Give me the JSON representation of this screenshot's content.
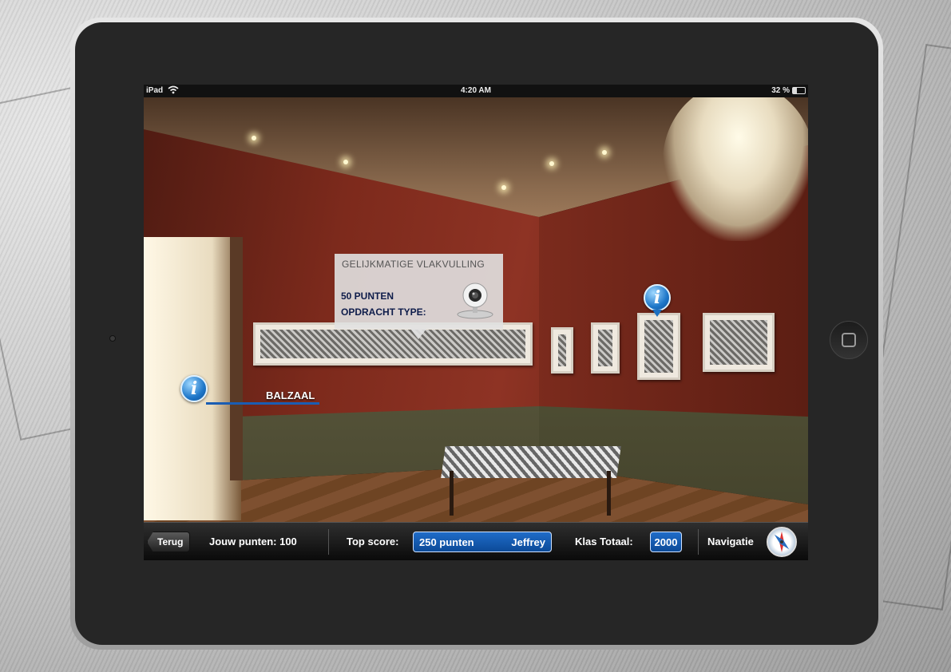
{
  "status_bar": {
    "device": "iPad",
    "time": "4:20 AM",
    "battery": "32 %"
  },
  "hotspots": {
    "room_label": "BALZAAL",
    "info_icon": "i"
  },
  "callout": {
    "title": "GELIJKMATIGE VLAKVULLING",
    "points": "50 PUNTEN",
    "type_label": "OPDRACHT TYPE:",
    "type_icon": "webcam-icon"
  },
  "toolbar": {
    "back_label": "Terug",
    "your_points": "Jouw punten: 100",
    "top_score_label": "Top score:",
    "top_score_points": "250 punten",
    "top_score_name": "Jeffrey",
    "class_total_label": "Klas Totaal:",
    "class_total_value": "2000",
    "navigation_label": "Navigatie",
    "navigation_icon": "compass-icon"
  },
  "colors": {
    "accent_blue": "#1a5db3",
    "toolbar_bg": "#1a1a1a",
    "device_bezel": "#262626"
  }
}
